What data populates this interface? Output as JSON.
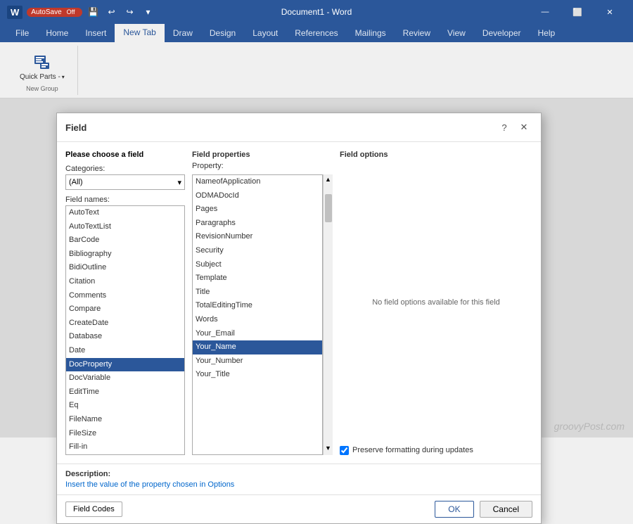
{
  "titlebar": {
    "autosave_label": "AutoSave",
    "autosave_state": "Off",
    "document_title": "Document1 - Word",
    "app_name": "Word"
  },
  "ribbon": {
    "tabs": [
      "File",
      "Home",
      "Insert",
      "New Tab",
      "Draw",
      "Design",
      "Layout",
      "References",
      "Mailings",
      "Review",
      "View",
      "Developer",
      "Help"
    ],
    "active_tab": "New Tab",
    "groups": [
      {
        "name": "Quick Parts",
        "label": "Quick Parts -",
        "group_label": "New Group"
      }
    ]
  },
  "dialog": {
    "title": "Field",
    "choose_label": "Please choose a field",
    "categories_label": "Categories:",
    "categories_value": "(All)",
    "field_names_label": "Field names:",
    "field_names": [
      "AutoText",
      "AutoTextList",
      "BarCode",
      "Bibliography",
      "BidiOutline",
      "Citation",
      "Comments",
      "Compare",
      "CreateDate",
      "Database",
      "Date",
      "DocProperty",
      "DocVariable",
      "EditTime",
      "Eq",
      "FileName",
      "FileSize",
      "Fill-in"
    ],
    "selected_field": "DocProperty",
    "field_properties_label": "Field properties",
    "property_label": "Property:",
    "properties": [
      "NameofApplication",
      "ODMADocId",
      "Pages",
      "Paragraphs",
      "RevisionNumber",
      "Security",
      "Subject",
      "Template",
      "Title",
      "TotalEditingTime",
      "Words",
      "Your_Email",
      "Your_Name",
      "Your_Number",
      "Your_Title"
    ],
    "selected_property": "Your_Name",
    "field_options_label": "Field options",
    "no_options_text": "No field options available for this field",
    "preserve_label": "Preserve formatting during updates",
    "preserve_checked": true,
    "description_label": "Description:",
    "description_text": "Insert the value of the property chosen in Options",
    "btn_field_codes": "Field Codes",
    "btn_ok": "OK",
    "btn_cancel": "Cancel"
  },
  "watermark": "groovyPost.com"
}
